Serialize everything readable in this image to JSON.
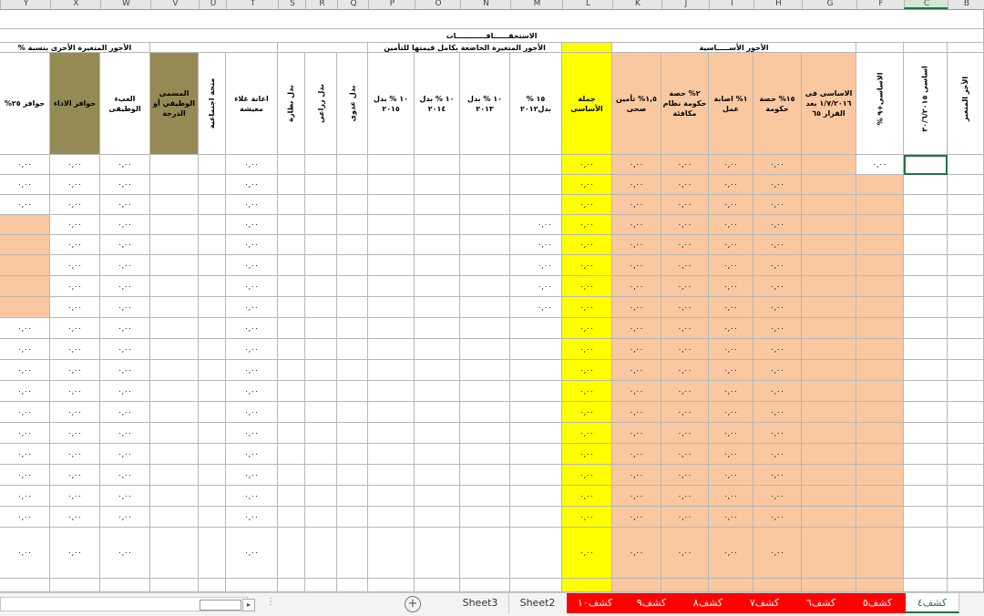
{
  "columns": [
    "Y",
    "X",
    "W",
    "V",
    "U",
    "T",
    "S",
    "R",
    "Q",
    "P",
    "O",
    "N",
    "M",
    "L",
    "K",
    "J",
    "I",
    "H",
    "G",
    "F",
    "C",
    "B"
  ],
  "selected_column": "C",
  "title_row": "الاستحقــــــاقــــــــــــات",
  "groups": {
    "other_variable": "الأجور المتغيرة الأخرى بنسبة  %",
    "insured_variable": "الأجور المتغيرة الخاضعة بكامل قيمتها للتأمين",
    "basic": "الأجور الأســـــاسية"
  },
  "headers": {
    "Y": "حوافز ٢٥%",
    "X": "حوافز الاداء",
    "W": "العبء الوظيفى",
    "V": "المسمى الوظيفي أو الدرجة",
    "U": "منحة اجتماعية",
    "T": "اعانة غلاء معيشة",
    "S": "بدل نظارة",
    "R": "بدل زراعى",
    "Q": "بدل عدوى",
    "P": "١٠ % بدل ٢٠١٥",
    "O": "١٠ % بدل ٢٠١٤",
    "N": "١٠ % بدل ٢٠١٣",
    "M": "١٥ % بدل٢٠١٢",
    "L": "جملة الأساسى",
    "K": "١,٥% تأمين صحى",
    "J": "٢% حصة حكومة نظام مكافئة",
    "I": "١% اصابة عمل",
    "H": "١٥% حصة حكومة",
    "G": "الاساسى فى ١/٧/٢٠١٦ بعد القرار ٦٥",
    "F": "الاساسى+٩ %",
    "C": "اساسى ٣٠/٦/٢٠١٥",
    "B": "الأجر المتغير"
  },
  "zero_value": "٠,٠٠",
  "sheet_tabs": {
    "sheet3": "Sheet3",
    "sheet2": "Sheet2",
    "k10": "كشف١٠",
    "k9": "كشف٩",
    "k8": "كشف٨",
    "k7": "كشف٧",
    "k6": "كشف٦",
    "k5": "كشف٥",
    "k4": "كشف٤"
  },
  "active_tab": "كشف٤",
  "colors": {
    "peach": "#f9c8a0",
    "yellow": "#ffff00",
    "olive": "#948a54",
    "red_tab": "#ff0000",
    "excel_green": "#217346"
  }
}
